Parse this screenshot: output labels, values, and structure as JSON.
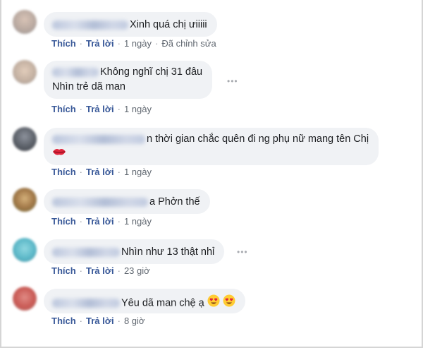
{
  "comments": [
    {
      "text_lines": [
        "Xinh quá chị ưiiiii"
      ],
      "actions": {
        "like": "Thích",
        "reply": "Trả lời",
        "time": "1 ngày",
        "extra": "Đã chỉnh sửa"
      }
    },
    {
      "text_lines": [
        "Không nghĩ chị 31 đâu",
        "Nhìn trẻ dã man"
      ],
      "actions": {
        "like": "Thích",
        "reply": "Trả lời",
        "time": "1 ngày"
      }
    },
    {
      "text_lines": [
        "n thời gian chắc quên đi ng phụ nữ mang tên Chị"
      ],
      "emoji": "lips-emoji",
      "actions": {
        "like": "Thích",
        "reply": "Trả lời",
        "time": "1 ngày"
      }
    },
    {
      "text_lines": [
        "a Phởn thế"
      ],
      "actions": {
        "like": "Thích",
        "reply": "Trả lời",
        "time": "1 ngày"
      }
    },
    {
      "text_lines": [
        "Nhìn như 13 thật nhỉ"
      ],
      "actions": {
        "like": "Thích",
        "reply": "Trả lời",
        "time": "23 giờ"
      }
    },
    {
      "text_lines": [
        "Yêu dã man chệ ạ"
      ],
      "emoji": "heart-eyes-emoji",
      "actions": {
        "like": "Thích",
        "reply": "Trả lời",
        "time": "8 giờ"
      }
    }
  ],
  "separator": "·",
  "colors": {
    "bubble": "#f0f2f5",
    "link": "#385898",
    "text": "#1c1e21"
  }
}
